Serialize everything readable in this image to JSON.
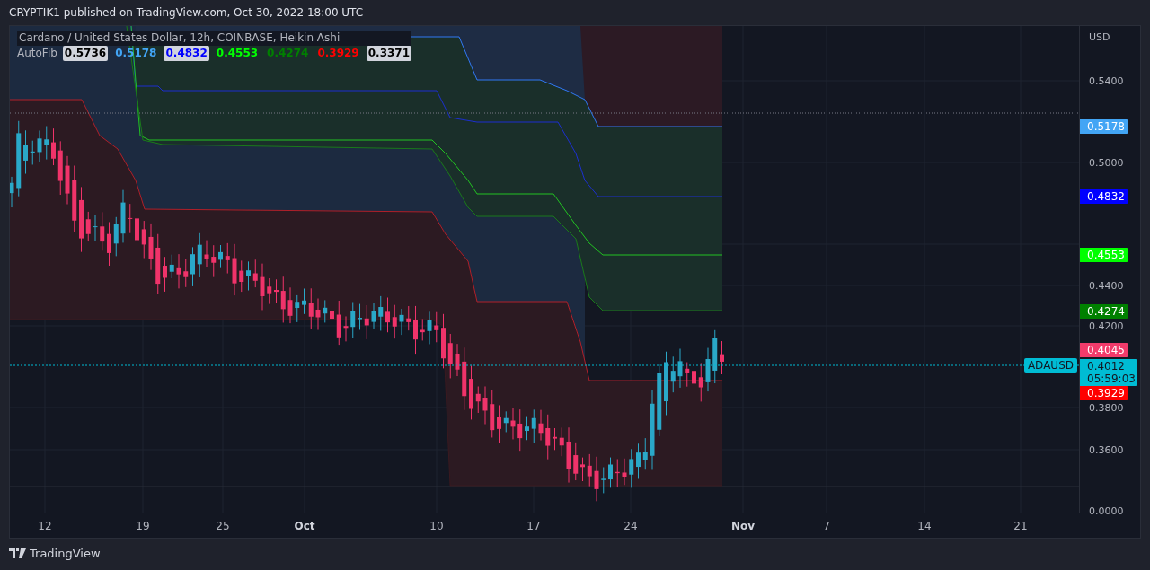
{
  "header": {
    "text": "CRYPTIK1 published on TradingView.com, Oct 30, 2022 18:00 UTC"
  },
  "chart": {
    "title": "Cardano / United States Dollar, 12h, COINBASE, Heikin Ashi",
    "indicator": {
      "name": "AutoFib",
      "values": [
        {
          "text": "0.5736",
          "color": "#000000"
        },
        {
          "text": "0.5178",
          "color": "#42a5f5"
        },
        {
          "text": "0.4832",
          "color": "#0000ff"
        },
        {
          "text": "0.4553",
          "color": "#00ff00"
        },
        {
          "text": "0.4274",
          "color": "#008000"
        },
        {
          "text": "0.3929",
          "color": "#ff0000"
        },
        {
          "text": "0.3371",
          "color": "#000000"
        }
      ]
    },
    "price_axis": {
      "unit": "USD",
      "labels": [
        "0.5400",
        "0.5000",
        "0.4400",
        "0.4200",
        "0.3800",
        "0.3600",
        "0.0000"
      ]
    },
    "price_tags": [
      {
        "text": "0.5178",
        "color": "#42a5f5"
      },
      {
        "text": "0.4832",
        "color": "#0000ff"
      },
      {
        "text": "0.4553",
        "color": "#00ff00"
      },
      {
        "text": "0.4274",
        "color": "#008000"
      },
      {
        "text": "0.4045",
        "color": "#f23b6b"
      },
      {
        "text": "0.3929",
        "color": "#ff0000"
      }
    ],
    "last_price": {
      "symbol": "ADAUSD",
      "price": "0.4012",
      "countdown": "05:59:03"
    },
    "time_axis": {
      "labels": [
        {
          "text": "12",
          "kind": "day"
        },
        {
          "text": "19",
          "kind": "day"
        },
        {
          "text": "25",
          "kind": "day"
        },
        {
          "text": "Oct",
          "kind": "month"
        },
        {
          "text": "10",
          "kind": "day"
        },
        {
          "text": "17",
          "kind": "day"
        },
        {
          "text": "24",
          "kind": "day"
        },
        {
          "text": "Nov",
          "kind": "month"
        },
        {
          "text": "7",
          "kind": "day"
        },
        {
          "text": "14",
          "kind": "day"
        },
        {
          "text": "21",
          "kind": "day"
        }
      ]
    }
  },
  "footer": {
    "brand": "TradingView"
  }
}
